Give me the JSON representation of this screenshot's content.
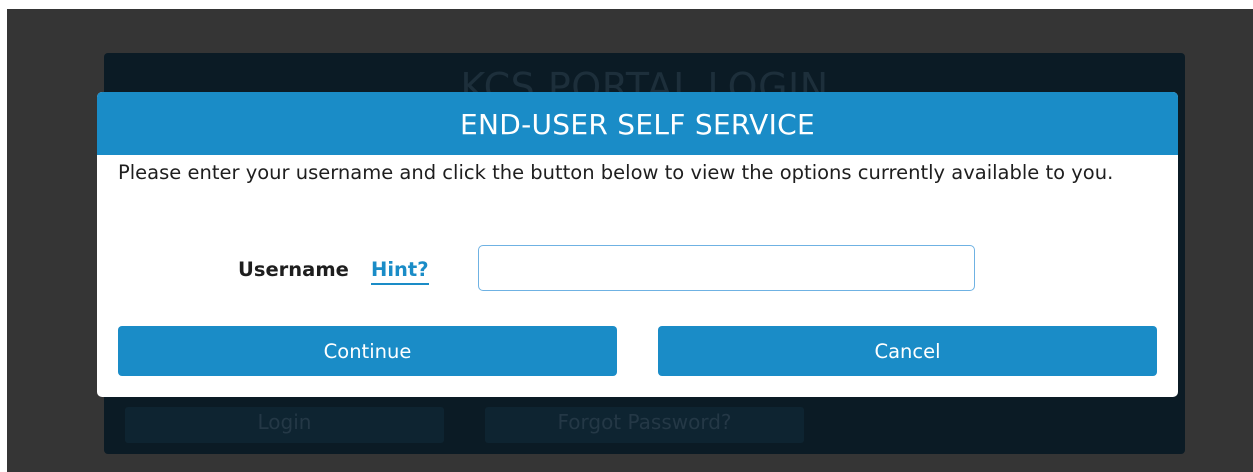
{
  "background_page": {
    "title": "KCS PORTAL LOGIN",
    "login_button": "Login",
    "forgot_password_button": "Forgot Password?"
  },
  "modal": {
    "title": "END-USER SELF SERVICE",
    "message": "Please enter your username and click the button below to view the options currently available to you.",
    "username_label": "Username",
    "hint_link": "Hint?",
    "username_value": "",
    "username_placeholder": "",
    "continue_button": "Continue",
    "cancel_button": "Cancel"
  },
  "colors": {
    "accent": "#1a8cc7",
    "overlay": "#353535",
    "background_panel": "#0b1b25"
  }
}
